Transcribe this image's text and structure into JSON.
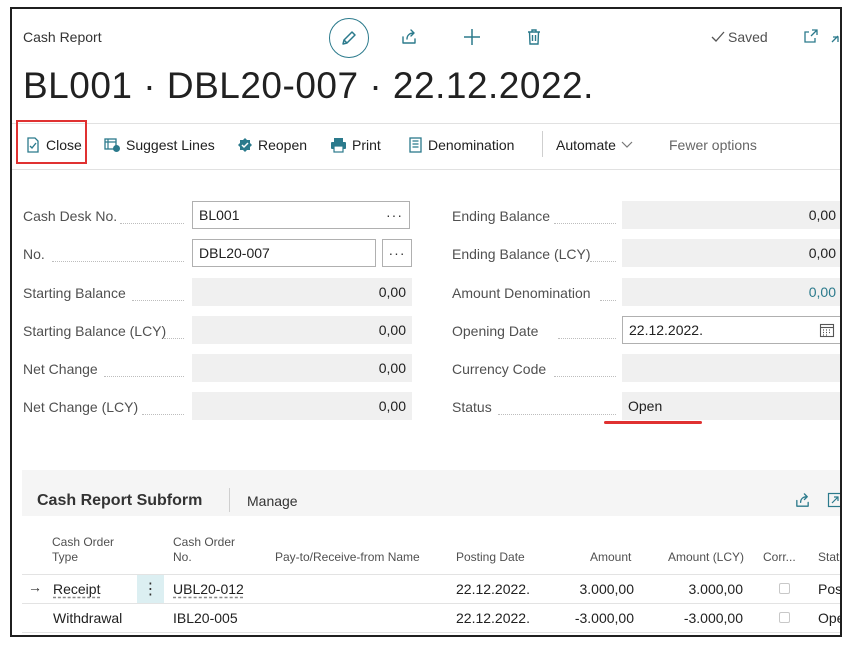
{
  "header": {
    "breadcrumb": "Cash Report",
    "title": "BL001 · DBL20-007 · 22.12.2022.",
    "saved_label": "Saved"
  },
  "actions": {
    "close": "Close",
    "suggest_lines": "Suggest Lines",
    "reopen": "Reopen",
    "print": "Print",
    "denomination": "Denomination",
    "automate": "Automate",
    "fewer_options": "Fewer options"
  },
  "fields_left": [
    {
      "label": "Cash Desk No.",
      "value": "BL001"
    },
    {
      "label": "No.",
      "value": "DBL20-007"
    },
    {
      "label": "Starting Balance",
      "value": "0,00"
    },
    {
      "label": "Starting Balance (LCY)",
      "value": "0,00"
    },
    {
      "label": "Net Change",
      "value": "0,00"
    },
    {
      "label": "Net Change (LCY)",
      "value": "0,00"
    }
  ],
  "fields_right": [
    {
      "label": "Ending Balance",
      "value": "0,00"
    },
    {
      "label": "Ending Balance (LCY)",
      "value": "0,00"
    },
    {
      "label": "Amount Denomination",
      "value": "0,00"
    },
    {
      "label": "Opening Date",
      "value": "22.12.2022."
    },
    {
      "label": "Currency Code",
      "value": ""
    },
    {
      "label": "Status",
      "value": "Open"
    }
  ],
  "subform": {
    "title": "Cash Report Subform",
    "manage": "Manage",
    "columns": {
      "cash_order_type": "Cash Order Type",
      "cash_order_no": "Cash Order No.",
      "pay_to": "Pay-to/Receive-from Name",
      "posting_date": "Posting Date",
      "amount": "Amount",
      "amount_lcy": "Amount (LCY)",
      "corr": "Corr...",
      "status": "Statu"
    },
    "rows": [
      {
        "type": "Receipt",
        "no": "UBL20-012",
        "name": "",
        "date": "22.12.2022.",
        "amount": "3.000,00",
        "amount_lcy": "3.000,00",
        "status": "Pos"
      },
      {
        "type": "Withdrawal",
        "no": "IBL20-005",
        "name": "",
        "date": "22.12.2022.",
        "amount": "-3.000,00",
        "amount_lcy": "-3.000,00",
        "status": "Ope"
      }
    ]
  },
  "colors": {
    "accent": "#2b7a8c",
    "highlight": "#e03131"
  }
}
